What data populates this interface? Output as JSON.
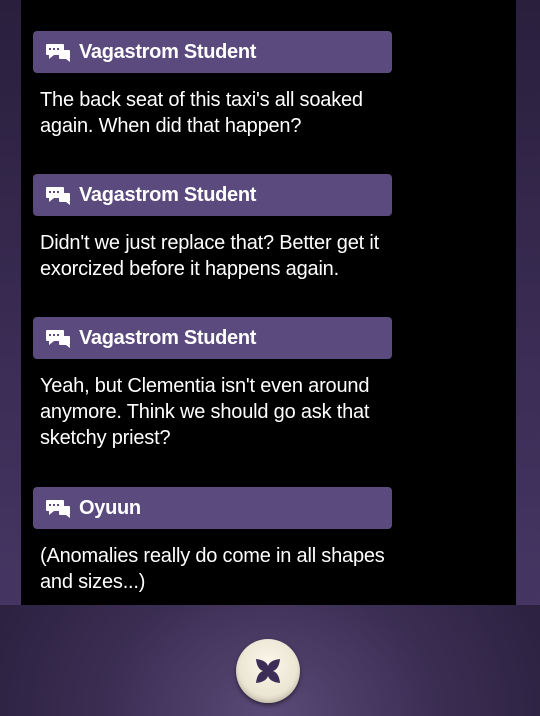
{
  "log": {
    "entries": [
      {
        "speaker": "Vagastrom Student",
        "text": "The back seat of this taxi's all soaked again. When did that happen?",
        "icon": "speech-bubble-icon"
      },
      {
        "speaker": "Vagastrom Student",
        "text": "Didn't we just replace that? Better get it exorcized before it happens again.",
        "icon": "speech-bubble-icon"
      },
      {
        "speaker": "Vagastrom Student",
        "text": "Yeah, but Clementia isn't even around anymore. Think we should go ask that sketchy priest?",
        "icon": "speech-bubble-icon"
      },
      {
        "speaker": "Oyuun",
        "text": "(Anomalies really do come in all shapes and sizes...)",
        "icon": "speech-bubble-icon"
      }
    ]
  },
  "close_button": {
    "icon": "close-x-icon"
  },
  "colors": {
    "speaker_bar": "#5b4a7e",
    "panel": "#000000",
    "text": "#ffffff",
    "close_x": "#3b2d55"
  }
}
